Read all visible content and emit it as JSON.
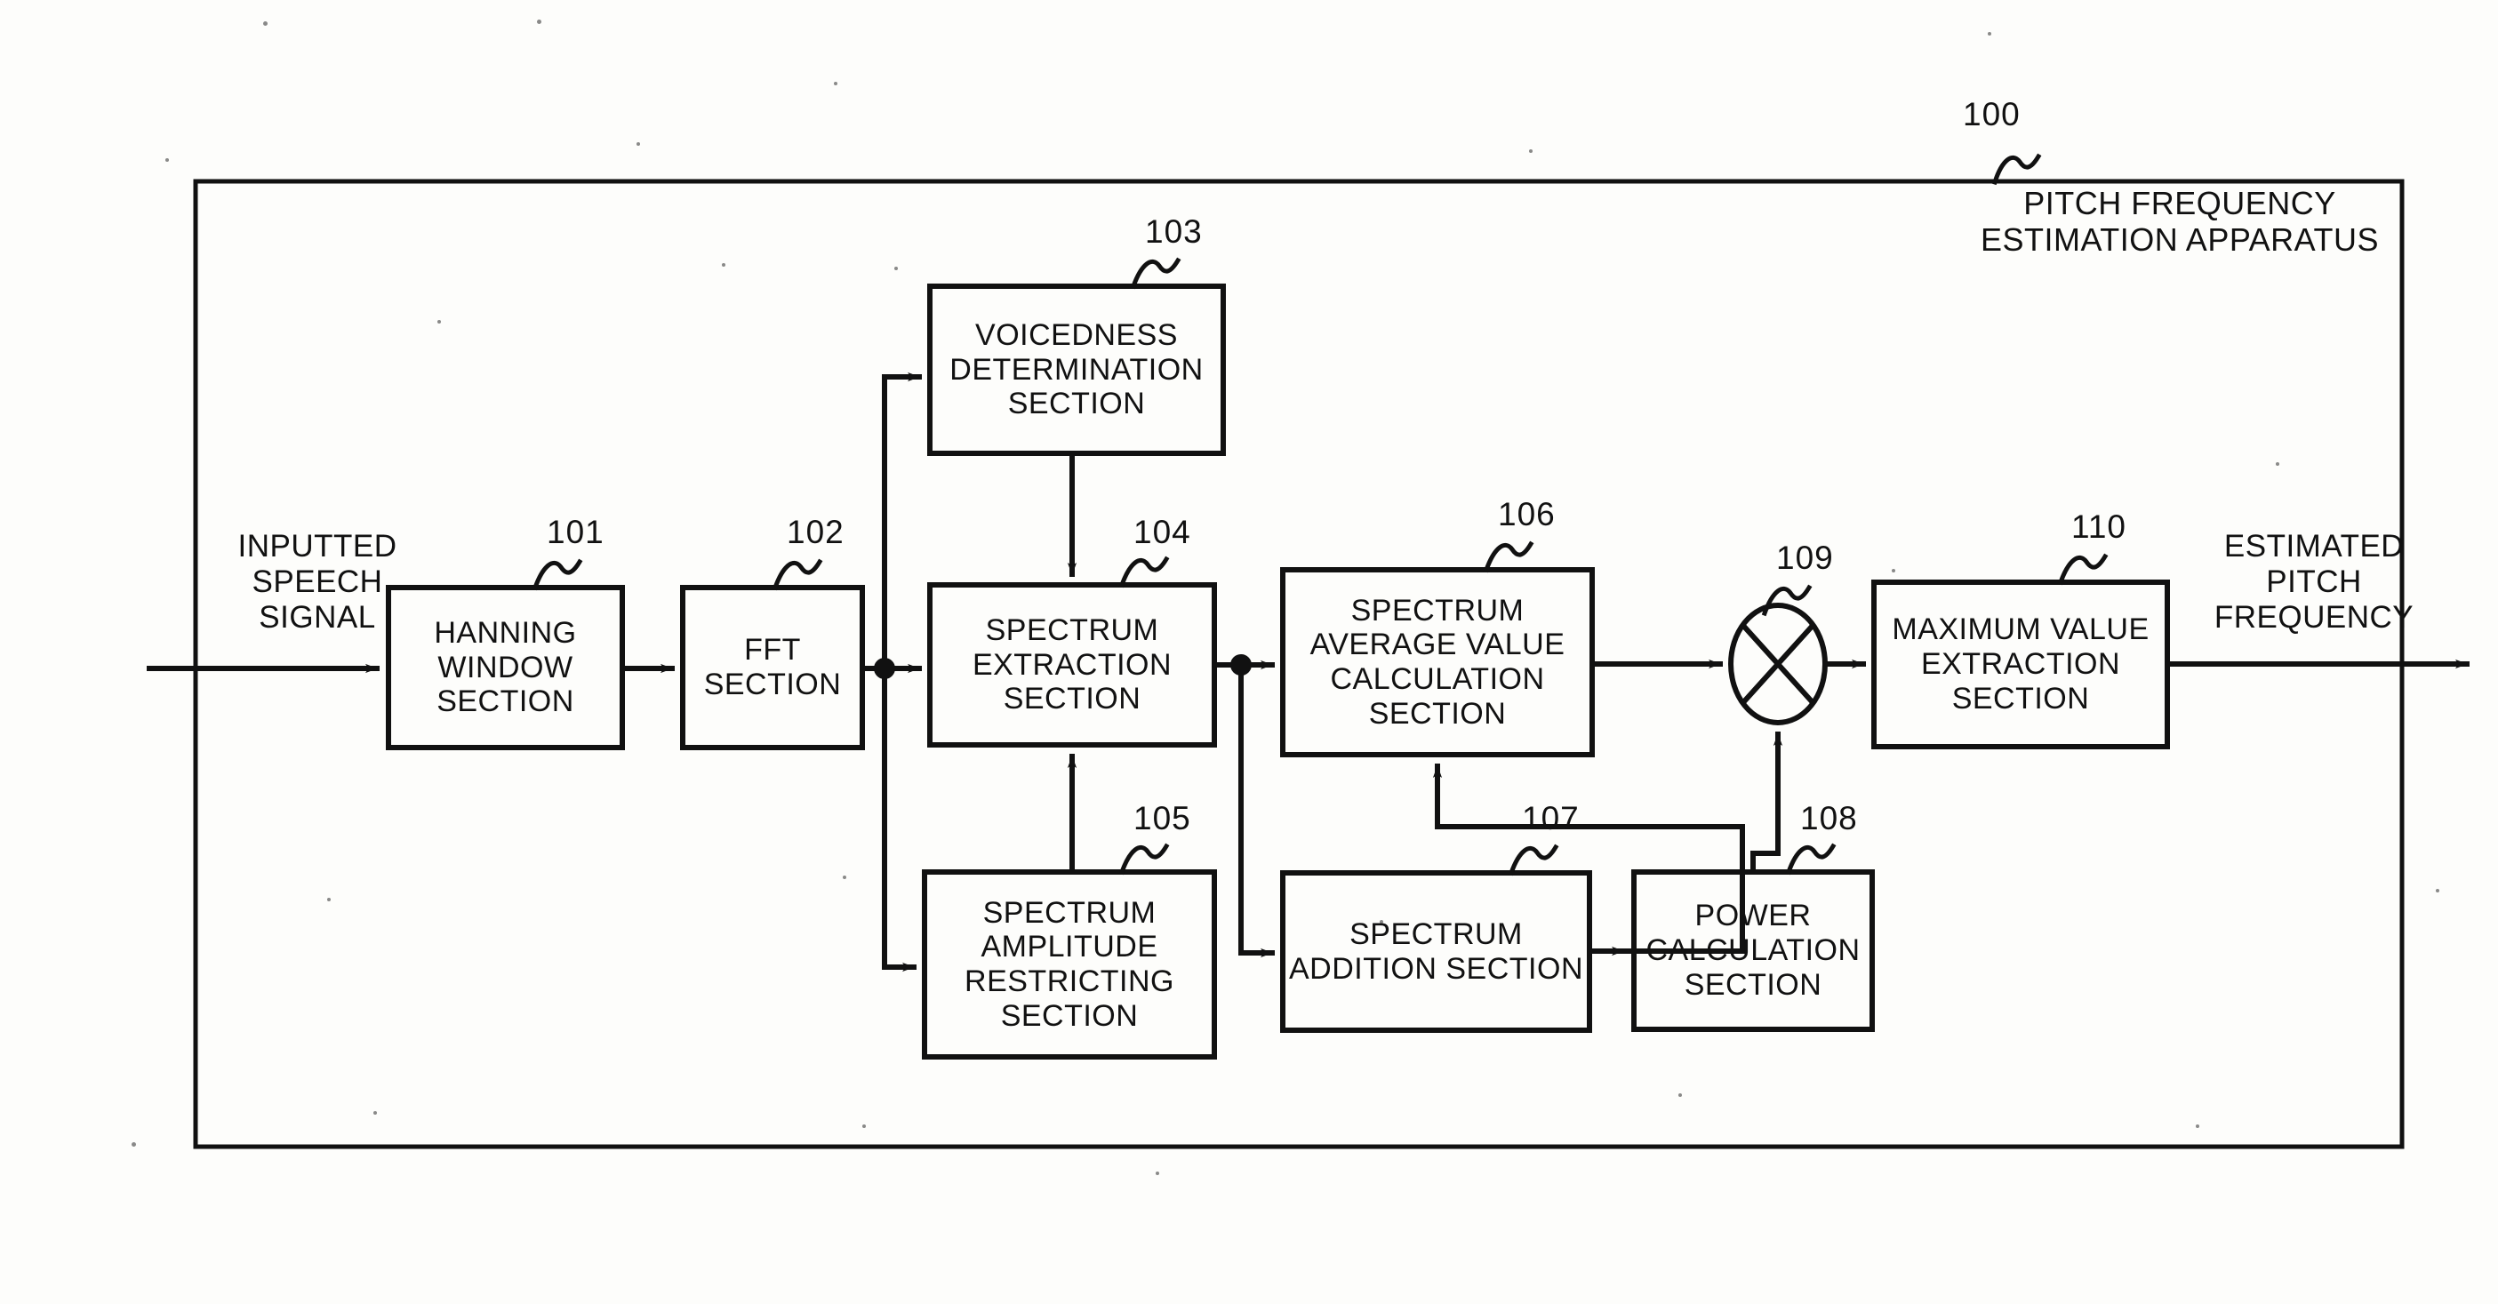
{
  "figure": {
    "apparatus_ref": "100",
    "apparatus_title_line1": "PITCH FREQUENCY",
    "apparatus_title_line2": "ESTIMATION APPARATUS",
    "input_label_line1": "INPUTTED",
    "input_label_line2": "SPEECH",
    "input_label_line3": "SIGNAL",
    "output_label_line1": "ESTIMATED",
    "output_label_line2": "PITCH",
    "output_label_line3": "FREQUENCY"
  },
  "blocks": [
    {
      "ref": "101",
      "name": "hanning-window-section",
      "lines": [
        "HANNING",
        "WINDOW",
        "SECTION"
      ]
    },
    {
      "ref": "102",
      "name": "fft-section",
      "lines": [
        "FFT",
        "SECTION"
      ]
    },
    {
      "ref": "103",
      "name": "voicedness-determination-section",
      "lines": [
        "VOICEDNESS",
        "DETERMINATION",
        "SECTION"
      ]
    },
    {
      "ref": "104",
      "name": "spectrum-extraction-section",
      "lines": [
        "SPECTRUM",
        "EXTRACTION",
        "SECTION"
      ]
    },
    {
      "ref": "105",
      "name": "spectrum-amplitude-restricting-section",
      "lines": [
        "SPECTRUM",
        "AMPLITUDE",
        "RESTRICTING",
        "SECTION"
      ]
    },
    {
      "ref": "106",
      "name": "spectrum-average-value-calculation-section",
      "lines": [
        "SPECTRUM",
        "AVERAGE VALUE",
        "CALCULATION",
        "SECTION"
      ]
    },
    {
      "ref": "107",
      "name": "spectrum-addition-section",
      "lines": [
        "SPECTRUM",
        "ADDITION SECTION"
      ]
    },
    {
      "ref": "108",
      "name": "power-calculation-section",
      "lines": [
        "POWER",
        "CALCULATION",
        "SECTION"
      ]
    },
    {
      "ref": "109",
      "name": "multiplier",
      "lines": []
    },
    {
      "ref": "110",
      "name": "maximum-value-extraction-section",
      "lines": [
        "MAXIMUM VALUE",
        "EXTRACTION",
        "SECTION"
      ]
    }
  ],
  "colors": {
    "ink": "#111111",
    "paper": "#fdfdfb"
  }
}
